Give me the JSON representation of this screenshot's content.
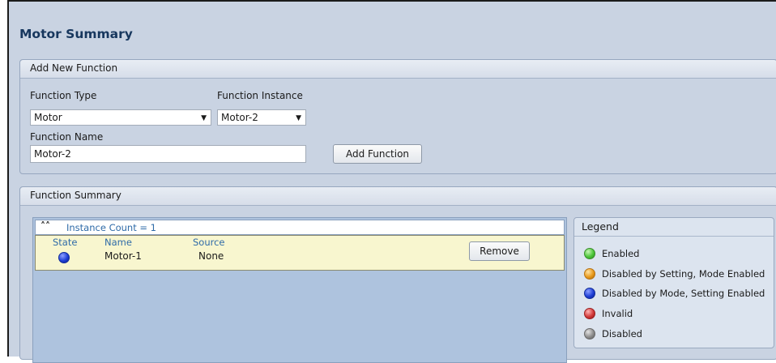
{
  "page": {
    "title": "Motor Summary"
  },
  "add_function": {
    "header": "Add New Function",
    "function_type_label": "Function Type",
    "function_type_value": "Motor",
    "function_instance_label": "Function Instance",
    "function_instance_value": "Motor-2",
    "function_name_label": "Function Name",
    "function_name_value": "Motor-2",
    "add_button": "Add Function"
  },
  "summary": {
    "header": "Function Summary",
    "instance_count": "Instance Count = 1",
    "columns": {
      "state": "State",
      "name": "Name",
      "source": "Source"
    },
    "rows": [
      {
        "state_color": "#1f3fd6",
        "name": "Motor-1",
        "source": "None",
        "remove_label": "Remove"
      }
    ]
  },
  "legend": {
    "title": "Legend",
    "items": [
      {
        "label": "Enabled",
        "color": "#4cc63a"
      },
      {
        "label": "Disabled by Setting, Mode Enabled",
        "color": "#e89a1c"
      },
      {
        "label": "Disabled by Mode, Setting Enabled",
        "color": "#1f3fd6"
      },
      {
        "label": "Invalid",
        "color": "#d23a3a"
      },
      {
        "label": "Disabled",
        "color": "#8e8e8e"
      }
    ]
  }
}
